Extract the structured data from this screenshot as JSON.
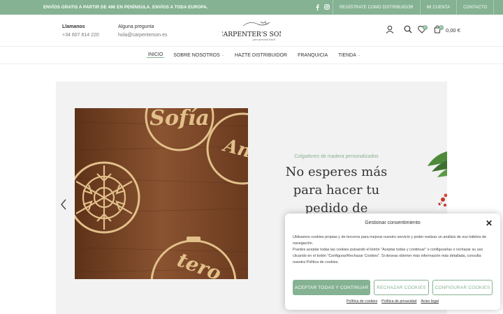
{
  "topbar": {
    "promo": "ENVÍOS GRATIS A PARTIR DE 49€ EN PENÍNSULA. ENVÍOS A TODA EUROPA.",
    "social_icons": [
      "facebook-icon",
      "instagram-icon"
    ],
    "links": [
      "REGÍSTRATE COMO DISTRIBUIDOR",
      "MI CUENTA",
      "CONTACTO"
    ]
  },
  "header": {
    "call_title": "Llamanos",
    "call_value": "+34 607 614 220",
    "question_title": "Alguna pregunta",
    "question_value": "hola@carpenterson.es",
    "logo_text": "CARPENTER'S SON",
    "logo_tagline": "your personal touch",
    "wishlist_count": "0",
    "cart_count": "0",
    "cart_total": "0,00 €"
  },
  "nav": {
    "items": [
      "INICIO",
      "SOBRE NOSOTROS",
      "HAZTE DISTRIBUIDOR",
      "FRANQUICIA",
      "TIENDA"
    ],
    "active": "INICIO"
  },
  "hero": {
    "subtitle": "Colgadores de madera personalizados",
    "headline": "No esperes más para hacer tu pedido de",
    "ornament_words": [
      "Sofía",
      "Andr",
      "tero"
    ]
  },
  "cookie": {
    "title": "Gestionar consentimiento",
    "text_1": "Utilizamos cookies propias y de terceros para mejorar nuestro servicio y poder realizar un análisis de sus hábitos de navegación.",
    "text_2": "Puedes aceptar todas las cookies pulsando el botón \"Aceptar todas y continuar\" o configurarlas o rechazar su uso clicando en el botón \"Configurar/Rechazar Cookies\". Si deseas obtener más información más detallada, consulta nuestra Política de cookies.",
    "btn_accept": "ACEPTAR TODAS Y CONTINUAR",
    "btn_reject": "RECHAZAR COOKIES",
    "btn_config": "CONFIGURAR COOKIES",
    "links": [
      "Política de cookies",
      "Política de privacidad",
      "Aviso legal"
    ]
  },
  "colors": {
    "accent": "#84b292",
    "wood": "#7a4526",
    "ornament": "#e2c08a"
  }
}
